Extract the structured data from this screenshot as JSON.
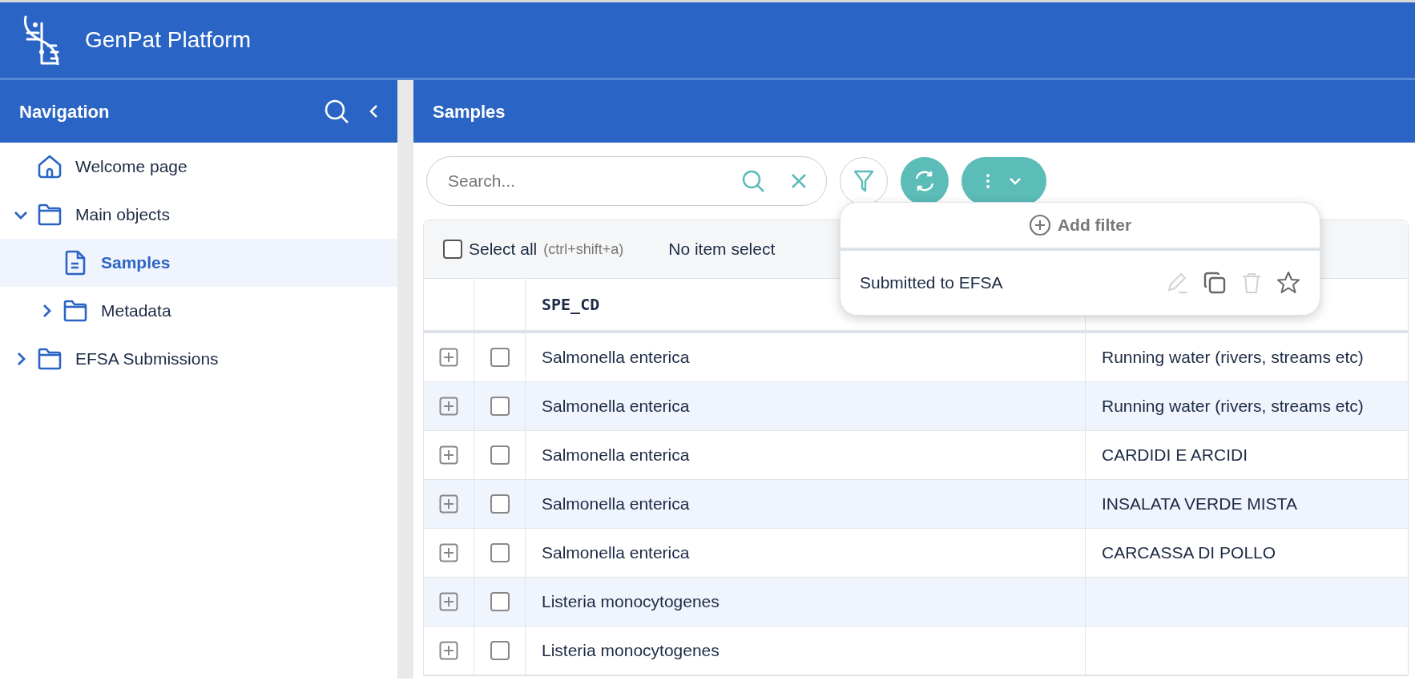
{
  "header": {
    "title": "GenPat Platform"
  },
  "navigation": {
    "title": "Navigation",
    "items": [
      {
        "label": "Welcome page",
        "kind": "home",
        "selected": false
      },
      {
        "label": "Main objects",
        "kind": "folder",
        "expanded": true,
        "selected": false,
        "children": [
          {
            "label": "Samples",
            "kind": "document",
            "selected": true
          },
          {
            "label": "Metadata",
            "kind": "folder",
            "expanded": false,
            "selected": false
          }
        ]
      },
      {
        "label": "EFSA Submissions",
        "kind": "folder",
        "expanded": false,
        "selected": false
      }
    ]
  },
  "main": {
    "title": "Samples",
    "search": {
      "placeholder": "Search..."
    },
    "selection_bar": {
      "select_all": "Select all",
      "shortcut": "(ctrl+shift+a)",
      "checked": false,
      "status": "No item select"
    },
    "filter_menu": {
      "add_label": "Add filter",
      "filters": [
        {
          "name": "Submitted to EFSA",
          "actions": [
            {
              "kind": "edit",
              "disabled": true
            },
            {
              "kind": "copy",
              "disabled": false
            },
            {
              "kind": "delete",
              "disabled": true
            },
            {
              "kind": "favorite",
              "disabled": false
            }
          ]
        }
      ]
    },
    "table": {
      "columns": [
        "SPE_CD"
      ],
      "rows": [
        {
          "spe_cd": "Salmonella enterica",
          "column_2": "Running water (rivers, streams etc)",
          "selected": false
        },
        {
          "spe_cd": "Salmonella enterica",
          "column_2": "Running water (rivers, streams etc)",
          "selected": false
        },
        {
          "spe_cd": "Salmonella enterica",
          "column_2": "CARDIDI E ARCIDI",
          "selected": false
        },
        {
          "spe_cd": "Salmonella enterica",
          "column_2": "INSALATA VERDE MISTA",
          "selected": false
        },
        {
          "spe_cd": "Salmonella enterica",
          "column_2": "CARCASSA DI POLLO",
          "selected": false
        },
        {
          "spe_cd": "Listeria monocytogenes",
          "selected": false
        },
        {
          "spe_cd": "Listeria monocytogenes",
          "selected": false
        }
      ]
    }
  }
}
